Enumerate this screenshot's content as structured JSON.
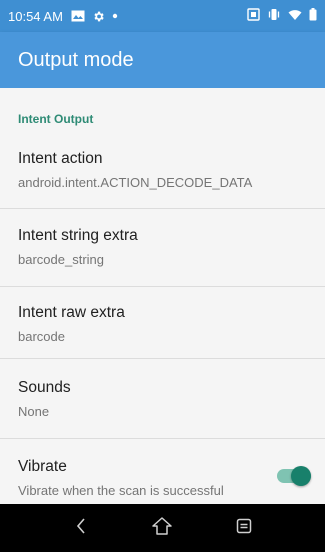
{
  "status_bar": {
    "time": "10:54 AM",
    "left_icons": [
      "image-icon",
      "gear-icon",
      "dot-icon"
    ],
    "right_icons": [
      "cast-icon",
      "vibrate-icon",
      "wifi-icon",
      "battery-icon"
    ]
  },
  "app_bar": {
    "title": "Output mode"
  },
  "section": {
    "header": "Intent Output"
  },
  "prefs": [
    {
      "title": "Intent action",
      "summary": "android.intent.ACTION_DECODE_DATA"
    },
    {
      "title": "Intent string extra",
      "summary": "barcode_string"
    },
    {
      "title": "Intent raw extra",
      "summary": "barcode"
    },
    {
      "title": "Sounds",
      "summary": "None"
    },
    {
      "title": "Vibrate",
      "summary": "Vibrate when the scan is successful",
      "toggle_on": true
    }
  ],
  "colors": {
    "status_bar": "#3f8fd2",
    "app_bar": "#4a97db",
    "accent": "#2e8b75",
    "toggle_thumb": "#18806b"
  },
  "nav_bar": {
    "icons": [
      "back-icon",
      "home-icon",
      "recents-icon"
    ]
  }
}
